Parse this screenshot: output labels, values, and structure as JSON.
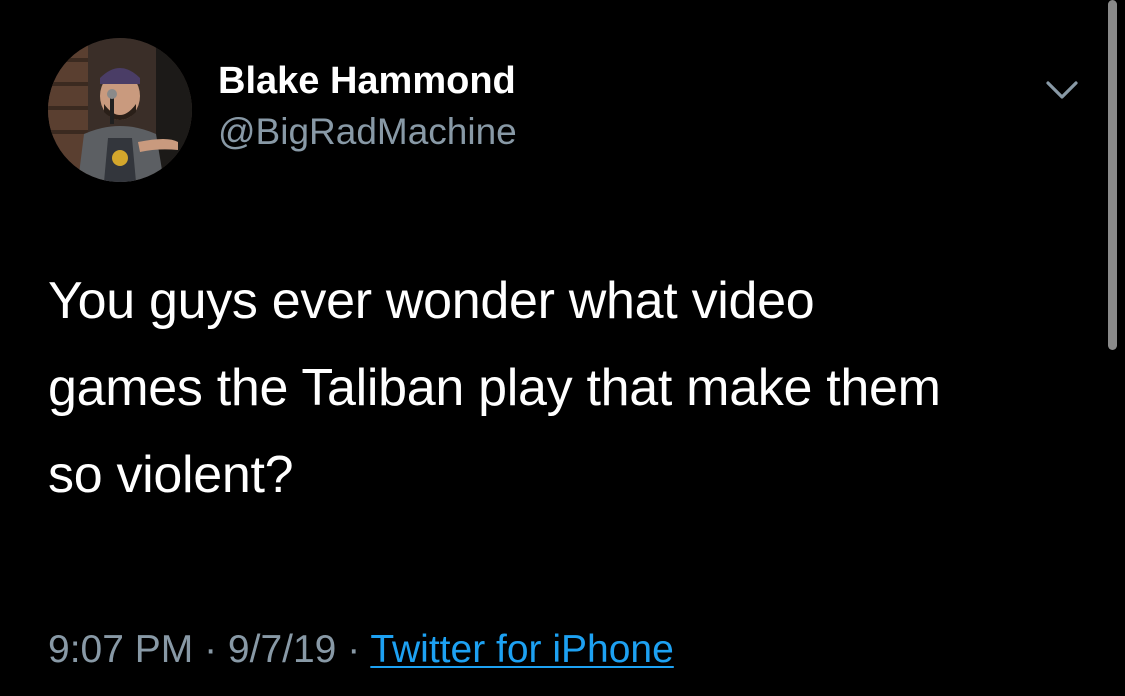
{
  "tweet": {
    "author": {
      "display_name": "Blake Hammond",
      "handle": "@BigRadMachine",
      "avatar_icon": "profile-photo"
    },
    "menu_icon": "chevron-down-icon",
    "text": "You guys ever wonder what video\ngames the Taliban play that make them\nso violent?",
    "meta": {
      "time": "9:07 PM",
      "separator": " · ",
      "date": "9/7/19",
      "source": "Twitter for iPhone"
    }
  },
  "colors": {
    "background": "#000000",
    "text": "#ffffff",
    "secondary": "#8899a6",
    "link": "#1da1f2"
  }
}
